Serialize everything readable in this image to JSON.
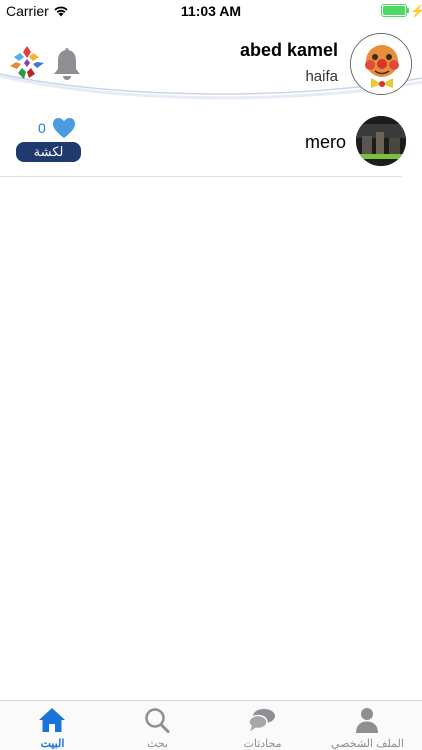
{
  "status_bar": {
    "carrier": "Carrier",
    "time": "11:03 AM"
  },
  "header": {
    "user_name": "abed kamel",
    "user_city": "haifa",
    "logo_icon": "colorful-diamond-logo-icon",
    "notification_icon": "bell-icon"
  },
  "feed": {
    "posts": [
      {
        "author": "mero",
        "likes": "0",
        "badge": "لكشة"
      }
    ]
  },
  "tab_bar": {
    "tabs": [
      {
        "label": "البيت",
        "icon": "home-icon",
        "active": true
      },
      {
        "label": "بحث",
        "icon": "search-icon",
        "active": false
      },
      {
        "label": "محادثات",
        "icon": "chat-bubbles-icon",
        "active": false
      },
      {
        "label": "الملف الشخصي",
        "icon": "person-icon",
        "active": false
      }
    ]
  },
  "colors": {
    "accent_blue": "#1a73d9",
    "badge_navy": "#1f3a6e",
    "heart_blue": "#4a9be0",
    "inactive_gray": "#8e8e93"
  }
}
